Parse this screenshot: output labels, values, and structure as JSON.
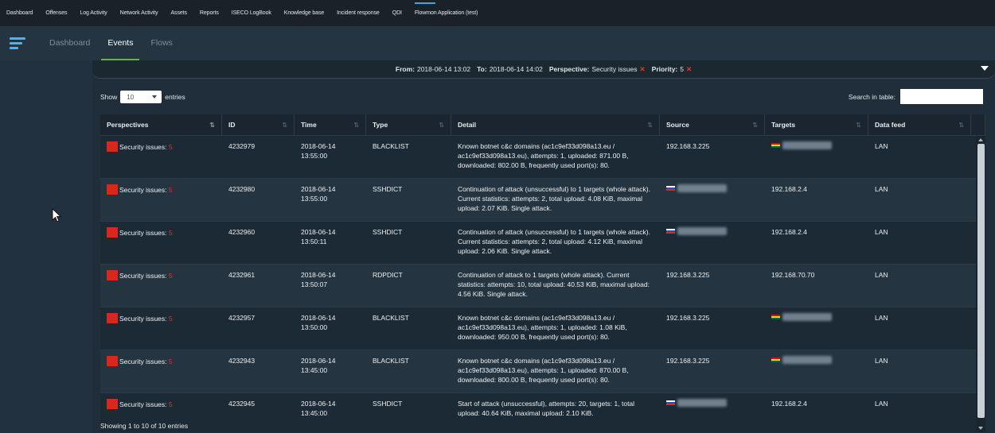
{
  "topnav": {
    "items": [
      "Dashboard",
      "Offenses",
      "Log Activity",
      "Network Activity",
      "Assets",
      "Reports",
      "ISECO LogBook",
      "Knowledge base",
      "Incident response",
      "QDI",
      "Flowmon Application (test)"
    ],
    "active_index": 10
  },
  "subnav": {
    "tabs": [
      "Dashboard",
      "Events",
      "Flows"
    ],
    "active": "Events"
  },
  "filter": {
    "from_label": "From:",
    "from_value": "2018-06-14 13:02",
    "to_label": "To:",
    "to_value": "2018-06-14 14:02",
    "perspective_label": "Perspective:",
    "perspective_value": "Security issues",
    "priority_label": "Priority:",
    "priority_value": "5",
    "remove_glyph": "✕"
  },
  "controls": {
    "show_label": "Show",
    "entries_value": "10",
    "entries_label": "entries",
    "search_label": "Search in table:"
  },
  "table": {
    "columns": [
      "Perspectives",
      "ID",
      "Time",
      "Type",
      "Detail",
      "Source",
      "Targets",
      "Data feed"
    ],
    "sorted_column": "Perspectives",
    "sort_icon": "⇅",
    "rows": [
      {
        "perspective": "Security issues:",
        "count": "5",
        "id": "4232979",
        "date": "2018-06-14",
        "time": "13:55:00",
        "type": "BLACKLIST",
        "detail": "Known botnet c&c domains (ac1c9ef33d098a13.eu / ac1c9ef33d098a13.eu), attempts: 1, uploaded: 871.00 B, downloaded: 802.00 B, frequently used port(s): 80.",
        "source": "192.168.3.225",
        "source_flag": "",
        "target": "",
        "target_flag": "gh",
        "feed": "LAN"
      },
      {
        "perspective": "Security issues:",
        "count": "5",
        "id": "4232980",
        "date": "2018-06-14",
        "time": "13:55:00",
        "type": "SSHDICT",
        "detail": "Continuation of attack (unsuccessful) to 1 targets (whole attack). Current statistics: attempts: 2, total upload: 4.08 KiB, maximal upload: 2.07 KiB. Single attack.",
        "source": "",
        "source_flag": "ru",
        "target": "192.168.2.4",
        "target_flag": "",
        "feed": "LAN"
      },
      {
        "perspective": "Security issues:",
        "count": "5",
        "id": "4232960",
        "date": "2018-06-14",
        "time": "13:50:11",
        "type": "SSHDICT",
        "detail": "Continuation of attack (unsuccessful) to 1 targets (whole attack). Current statistics: attempts: 2, total upload: 4.12 KiB, maximal upload: 2.06 KiB. Single attack.",
        "source": "",
        "source_flag": "ru",
        "target": "192.168.2.4",
        "target_flag": "",
        "feed": "LAN"
      },
      {
        "perspective": "Security issues:",
        "count": "5",
        "id": "4232961",
        "date": "2018-06-14",
        "time": "13:50:07",
        "type": "RDPDICT",
        "detail": "Continuation of attack to 1 targets (whole attack). Current statistics: attempts: 10, total upload: 40.53 KiB, maximal upload: 4.56 KiB. Single attack.",
        "source": "192.168.3.225",
        "source_flag": "",
        "target": "192.168.70.70",
        "target_flag": "",
        "feed": "LAN"
      },
      {
        "perspective": "Security issues:",
        "count": "5",
        "id": "4232957",
        "date": "2018-06-14",
        "time": "13:50:00",
        "type": "BLACKLIST",
        "detail": "Known botnet c&c domains (ac1c9ef33d098a13.eu / ac1c9ef33d098a13.eu), attempts: 1, uploaded: 1.08 KiB, downloaded: 950.00 B, frequently used port(s): 80.",
        "source": "192.168.3.225",
        "source_flag": "",
        "target": "",
        "target_flag": "gh",
        "feed": "LAN"
      },
      {
        "perspective": "Security issues:",
        "count": "5",
        "id": "4232943",
        "date": "2018-06-14",
        "time": "13:45:00",
        "type": "BLACKLIST",
        "detail": "Known botnet c&c domains (ac1c9ef33d098a13.eu / ac1c9ef33d098a13.eu), attempts: 1, uploaded: 870.00 B, downloaded: 800.00 B, frequently used port(s): 80.",
        "source": "192.168.3.225",
        "source_flag": "",
        "target": "",
        "target_flag": "gh",
        "feed": "LAN"
      },
      {
        "perspective": "Security issues:",
        "count": "5",
        "id": "4232945",
        "date": "2018-06-14",
        "time": "13:45:00",
        "type": "SSHDICT",
        "detail": "Start of attack (unsuccessful), attempts: 20, targets: 1, total upload: 40.64 KiB, maximal upload: 2.10 KiB.",
        "source": "",
        "source_flag": "ru",
        "target": "192.168.2.4",
        "target_flag": "",
        "feed": "LAN"
      }
    ]
  },
  "footer": {
    "info": "Showing 1 to 10 of 10 entries"
  }
}
